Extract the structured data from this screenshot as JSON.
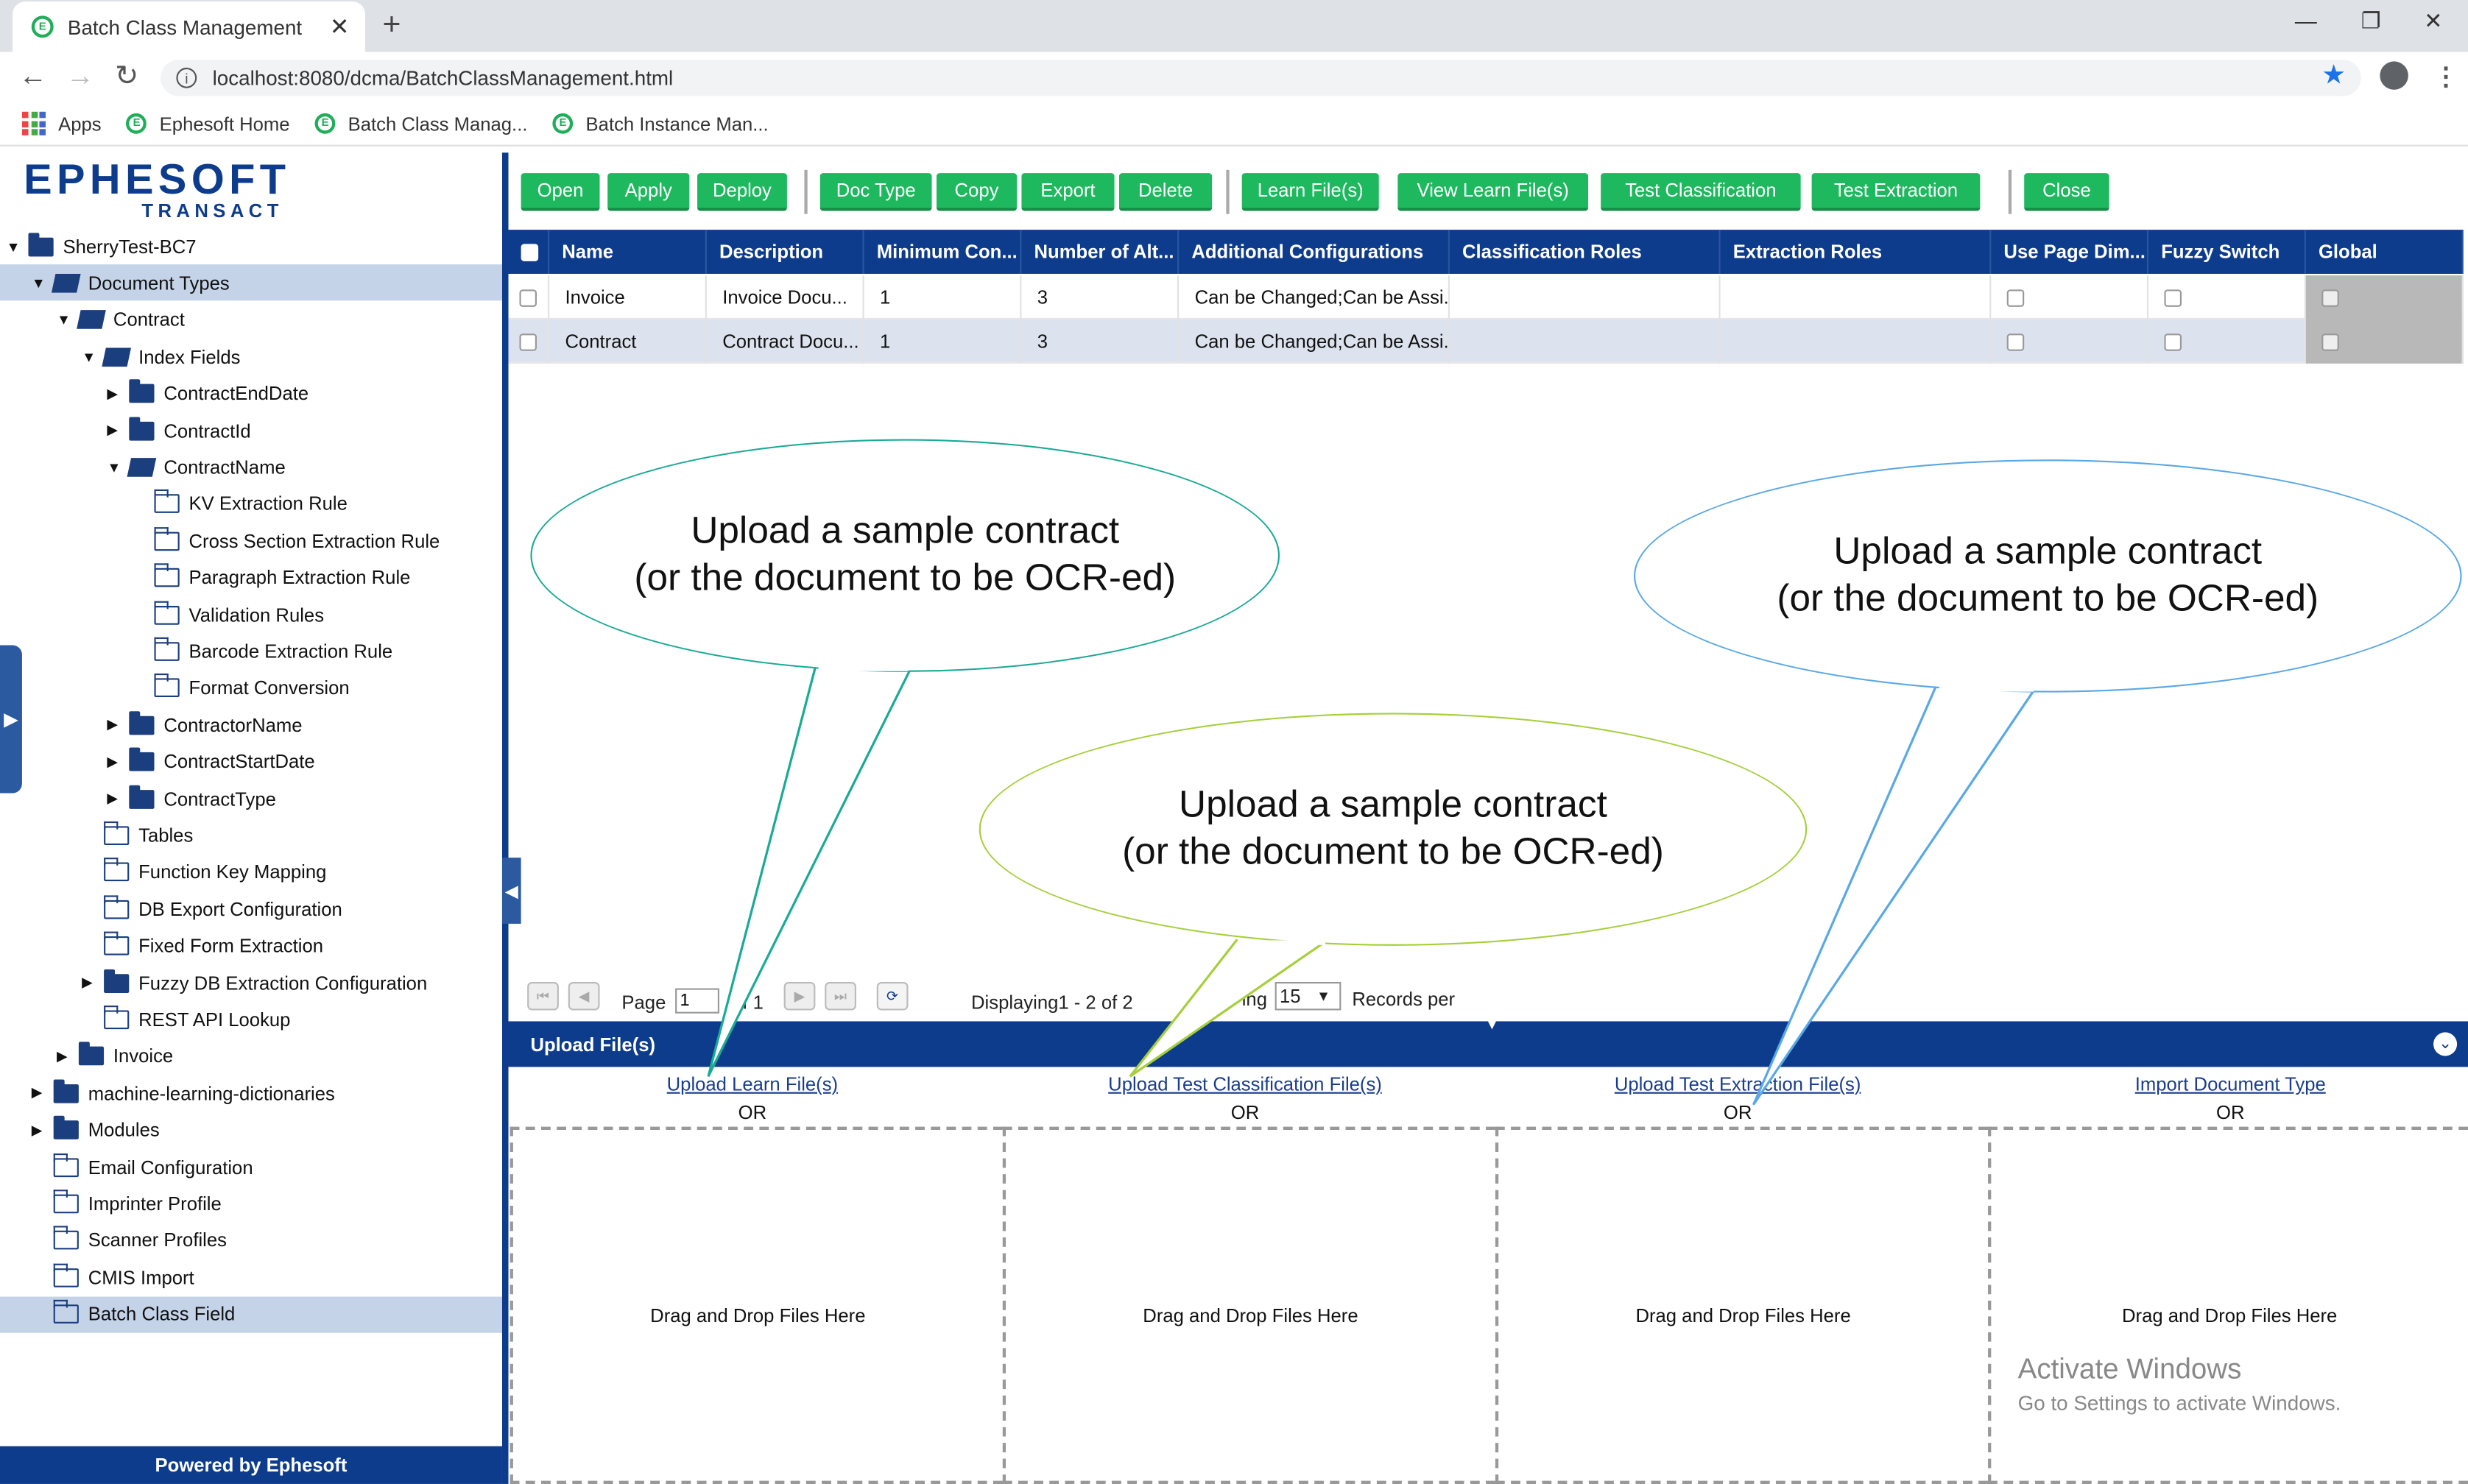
{
  "browser": {
    "tab_title": "Batch Class Management",
    "url": "localhost:8080/dcma/BatchClassManagement.html",
    "bookmarks": [
      "Apps",
      "Ephesoft Home",
      "Batch Class Manag...",
      "Batch Instance Man..."
    ]
  },
  "logo": {
    "main": "EPHESOFT",
    "sub": "TRANSACT"
  },
  "tree": {
    "items": [
      {
        "label": "SherryTest-BC7"
      },
      {
        "label": "Document Types"
      },
      {
        "label": "Contract"
      },
      {
        "label": "Index Fields"
      },
      {
        "label": "ContractEndDate"
      },
      {
        "label": "ContractId"
      },
      {
        "label": "ContractName"
      },
      {
        "label": "KV Extraction Rule"
      },
      {
        "label": "Cross Section Extraction Rule"
      },
      {
        "label": "Paragraph Extraction Rule"
      },
      {
        "label": "Validation Rules"
      },
      {
        "label": "Barcode Extraction Rule"
      },
      {
        "label": "Format Conversion"
      },
      {
        "label": "ContractorName"
      },
      {
        "label": "ContractStartDate"
      },
      {
        "label": "ContractType"
      },
      {
        "label": "Tables"
      },
      {
        "label": "Function Key Mapping"
      },
      {
        "label": "DB Export Configuration"
      },
      {
        "label": "Fixed Form Extraction"
      },
      {
        "label": "Fuzzy DB Extraction Configuration"
      },
      {
        "label": "REST API Lookup"
      },
      {
        "label": "Invoice"
      },
      {
        "label": "machine-learning-dictionaries"
      },
      {
        "label": "Modules"
      },
      {
        "label": "Email Configuration"
      },
      {
        "label": "Imprinter Profile"
      },
      {
        "label": "Scanner Profiles"
      },
      {
        "label": "CMIS Import"
      },
      {
        "label": "Batch Class Field"
      }
    ],
    "footer": "Powered by Ephesoft"
  },
  "toolbar": {
    "buttons": [
      "Open",
      "Apply",
      "Deploy",
      "Doc Type",
      "Copy",
      "Export",
      "Delete",
      "Learn File(s)",
      "View Learn File(s)",
      "Test Classification",
      "Test Extraction",
      "Close"
    ]
  },
  "grid": {
    "columns": [
      "Name",
      "Description",
      "Minimum Con...",
      "Number of Alt...",
      "Additional Configurations",
      "Classification Roles",
      "Extraction Roles",
      "Use Page Dim...",
      "Fuzzy Switch",
      "Global"
    ],
    "rows": [
      {
        "name": "Invoice",
        "description": "Invoice Docu...",
        "min": "1",
        "alt": "3",
        "config": "Can be Changed;Can be Assi..."
      },
      {
        "name": "Contract",
        "description": "Contract Docu...",
        "min": "1",
        "alt": "3",
        "config": "Can be Changed;Can be Assi..."
      }
    ]
  },
  "pager": {
    "page_label": "Page",
    "page_value": "1",
    "of_label": "of 1",
    "displaying": "Displaying1 - 2 of 2",
    "showing": "ing",
    "per_page": "15",
    "records_label": "Records per"
  },
  "upload": {
    "title": "Upload File(s)",
    "columns": [
      {
        "link": "Upload Learn File(s)",
        "or": "OR",
        "drop": "Drag and Drop Files Here"
      },
      {
        "link": "Upload Test Classification File(s)",
        "or": "OR",
        "drop": "Drag and Drop Files Here"
      },
      {
        "link": "Upload Test Extraction File(s)",
        "or": "OR",
        "drop": "Drag and Drop Files Here"
      },
      {
        "link": "Import Document Type",
        "or": "OR",
        "drop": "Drag and Drop Files Here"
      }
    ]
  },
  "callouts": [
    {
      "line1": "Upload a sample contract",
      "line2": "(or the document to be OCR-ed)",
      "color": "#1aaa96"
    },
    {
      "line1": "Upload a sample contract",
      "line2": "(or the document to be OCR-ed)",
      "color": "#a6cf3c"
    },
    {
      "line1": "Upload a sample contract",
      "line2": "(or the document to be OCR-ed)",
      "color": "#5aa8e6"
    }
  ],
  "watermark": {
    "line1": "Activate Windows",
    "line2": "Go to Settings to activate Windows."
  },
  "colors": {
    "brand_blue": "#0e3c8c",
    "button_green": "#1eb85f",
    "selected_row": "#c5d3e8"
  }
}
